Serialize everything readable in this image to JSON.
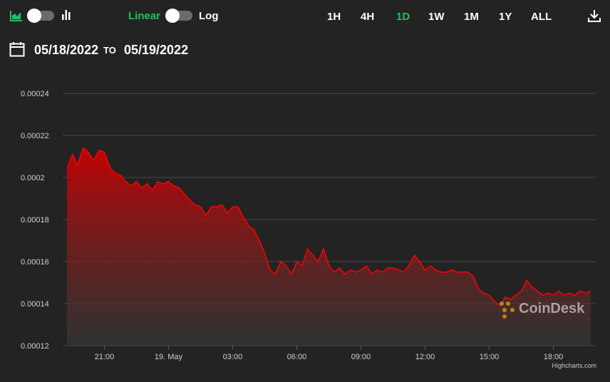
{
  "toolbar": {
    "chart_type_icons": [
      "area-chart-icon",
      "bar-chart-icon"
    ],
    "scale_left": "Linear",
    "scale_right": "Log",
    "ranges": [
      "1H",
      "4H",
      "1D",
      "1W",
      "1M",
      "1Y",
      "ALL"
    ],
    "active_range": "1D",
    "download_icon": "download-icon"
  },
  "date_range": {
    "from": "05/18/2022",
    "separator": "TO",
    "to": "05/19/2022",
    "icon": "calendar-icon"
  },
  "watermark": "CoinDesk",
  "credits": "Highcharts.com",
  "colors": {
    "background": "#232323",
    "accent_green": "#25c05e",
    "series_line": "#ff0000",
    "grid": "#4a4a4a"
  },
  "chart_data": {
    "type": "area",
    "title": "",
    "xlabel": "",
    "ylabel": "",
    "x_start": "2022-05-18 19:15",
    "x_end": "2022-05-19 19:45",
    "x_ticks": [
      {
        "time": "2022-05-18 21:00",
        "label": "21:00"
      },
      {
        "time": "2022-05-19 00:00",
        "label": "19. May"
      },
      {
        "time": "2022-05-19 03:00",
        "label": "03:00"
      },
      {
        "time": "2022-05-19 06:00",
        "label": "06:00"
      },
      {
        "time": "2022-05-19 09:00",
        "label": "09:00"
      },
      {
        "time": "2022-05-19 12:00",
        "label": "12:00"
      },
      {
        "time": "2022-05-19 15:00",
        "label": "15:00"
      },
      {
        "time": "2022-05-19 18:00",
        "label": "18:00"
      }
    ],
    "y_ticks": [
      {
        "value": 0.00012,
        "label": "0.00012"
      },
      {
        "value": 0.00014,
        "label": "0.00014"
      },
      {
        "value": 0.00016,
        "label": "0.00016"
      },
      {
        "value": 0.00018,
        "label": "0.00018"
      },
      {
        "value": 0.0002,
        "label": "0.0002"
      },
      {
        "value": 0.00022,
        "label": "0.00022"
      },
      {
        "value": 0.00024,
        "label": "0.00024"
      }
    ],
    "ylim": [
      0.00012,
      0.00024
    ],
    "grid": true,
    "legend": "none",
    "series": [
      {
        "points": [
          [
            "2022-05-18 19:15",
            0.000204
          ],
          [
            "2022-05-18 19:30",
            0.000211
          ],
          [
            "2022-05-18 19:45",
            0.000206
          ],
          [
            "2022-05-18 20:00",
            0.000214
          ],
          [
            "2022-05-18 20:15",
            0.000212
          ],
          [
            "2022-05-18 20:30",
            0.000208
          ],
          [
            "2022-05-18 20:45",
            0.000213
          ],
          [
            "2022-05-18 21:00",
            0.000212
          ],
          [
            "2022-05-18 21:15",
            0.000205
          ],
          [
            "2022-05-18 21:30",
            0.000202
          ],
          [
            "2022-05-18 21:45",
            0.000201
          ],
          [
            "2022-05-18 22:00",
            0.000198
          ],
          [
            "2022-05-18 22:15",
            0.000196
          ],
          [
            "2022-05-18 22:30",
            0.000198
          ],
          [
            "2022-05-18 22:45",
            0.000195
          ],
          [
            "2022-05-18 23:00",
            0.000197
          ],
          [
            "2022-05-18 23:15",
            0.000194
          ],
          [
            "2022-05-18 23:30",
            0.000198
          ],
          [
            "2022-05-18 23:45",
            0.000197
          ],
          [
            "2022-05-19 00:00",
            0.000198
          ],
          [
            "2022-05-19 00:15",
            0.000196
          ],
          [
            "2022-05-19 00:30",
            0.000195
          ],
          [
            "2022-05-19 00:45",
            0.000192
          ],
          [
            "2022-05-19 01:00",
            0.000189
          ],
          [
            "2022-05-19 01:15",
            0.000187
          ],
          [
            "2022-05-19 01:30",
            0.000186
          ],
          [
            "2022-05-19 01:45",
            0.000182
          ],
          [
            "2022-05-19 02:00",
            0.000186
          ],
          [
            "2022-05-19 02:15",
            0.000186
          ],
          [
            "2022-05-19 02:30",
            0.000187
          ],
          [
            "2022-05-19 02:45",
            0.000183
          ],
          [
            "2022-05-19 03:00",
            0.000186
          ],
          [
            "2022-05-19 03:15",
            0.000186
          ],
          [
            "2022-05-19 03:30",
            0.000181
          ],
          [
            "2022-05-19 03:45",
            0.000177
          ],
          [
            "2022-05-19 04:00",
            0.000175
          ],
          [
            "2022-05-19 04:15",
            0.00017
          ],
          [
            "2022-05-19 04:30",
            0.000164
          ],
          [
            "2022-05-19 04:45",
            0.000156
          ],
          [
            "2022-05-19 05:00",
            0.000154
          ],
          [
            "2022-05-19 05:15",
            0.00016
          ],
          [
            "2022-05-19 05:30",
            0.000158
          ],
          [
            "2022-05-19 05:45",
            0.000154
          ],
          [
            "2022-05-19 06:00",
            0.00016
          ],
          [
            "2022-05-19 06:15",
            0.000158
          ],
          [
            "2022-05-19 06:30",
            0.000166
          ],
          [
            "2022-05-19 06:45",
            0.000163
          ],
          [
            "2022-05-19 07:00",
            0.00016
          ],
          [
            "2022-05-19 07:15",
            0.000166
          ],
          [
            "2022-05-19 07:30",
            0.000158
          ],
          [
            "2022-05-19 07:45",
            0.000155
          ],
          [
            "2022-05-19 08:00",
            0.000157
          ],
          [
            "2022-05-19 08:15",
            0.000154
          ],
          [
            "2022-05-19 08:30",
            0.000156
          ],
          [
            "2022-05-19 08:45",
            0.000155
          ],
          [
            "2022-05-19 09:00",
            0.000156
          ],
          [
            "2022-05-19 09:15",
            0.000158
          ],
          [
            "2022-05-19 09:30",
            0.000154
          ],
          [
            "2022-05-19 09:45",
            0.000156
          ],
          [
            "2022-05-19 10:00",
            0.000155
          ],
          [
            "2022-05-19 10:15",
            0.000157
          ],
          [
            "2022-05-19 10:30",
            0.000157
          ],
          [
            "2022-05-19 10:45",
            0.000156
          ],
          [
            "2022-05-19 11:00",
            0.000155
          ],
          [
            "2022-05-19 11:15",
            0.000158
          ],
          [
            "2022-05-19 11:30",
            0.000163
          ],
          [
            "2022-05-19 11:45",
            0.00016
          ],
          [
            "2022-05-19 12:00",
            0.000156
          ],
          [
            "2022-05-19 12:15",
            0.000158
          ],
          [
            "2022-05-19 12:30",
            0.000156
          ],
          [
            "2022-05-19 12:45",
            0.000155
          ],
          [
            "2022-05-19 13:00",
            0.000155
          ],
          [
            "2022-05-19 13:15",
            0.000156
          ],
          [
            "2022-05-19 13:30",
            0.000155
          ],
          [
            "2022-05-19 13:45",
            0.000155
          ],
          [
            "2022-05-19 14:00",
            0.000155
          ],
          [
            "2022-05-19 14:15",
            0.000153
          ],
          [
            "2022-05-19 14:30",
            0.000147
          ],
          [
            "2022-05-19 14:45",
            0.000145
          ],
          [
            "2022-05-19 15:00",
            0.000144
          ],
          [
            "2022-05-19 15:15",
            0.000141
          ],
          [
            "2022-05-19 15:30",
            0.000139
          ],
          [
            "2022-05-19 15:45",
            0.000143
          ],
          [
            "2022-05-19 16:00",
            0.000142
          ],
          [
            "2022-05-19 16:15",
            0.000144
          ],
          [
            "2022-05-19 16:30",
            0.000146
          ],
          [
            "2022-05-19 16:45",
            0.000151
          ],
          [
            "2022-05-19 17:00",
            0.000148
          ],
          [
            "2022-05-19 17:15",
            0.000146
          ],
          [
            "2022-05-19 17:30",
            0.000144
          ],
          [
            "2022-05-19 17:45",
            0.000145
          ],
          [
            "2022-05-19 18:00",
            0.000144
          ],
          [
            "2022-05-19 18:15",
            0.000146
          ],
          [
            "2022-05-19 18:30",
            0.000144
          ],
          [
            "2022-05-19 18:45",
            0.000145
          ],
          [
            "2022-05-19 19:00",
            0.000144
          ],
          [
            "2022-05-19 19:15",
            0.000146
          ],
          [
            "2022-05-19 19:30",
            0.000145
          ],
          [
            "2022-05-19 19:45",
            0.000146
          ]
        ]
      }
    ]
  }
}
